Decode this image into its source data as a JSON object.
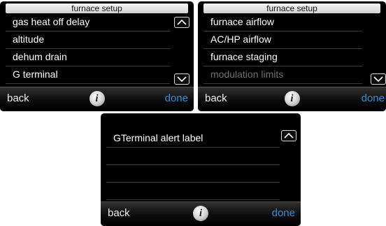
{
  "panel1": {
    "title": "furnace setup",
    "items": [
      {
        "label": "gas heat off delay"
      },
      {
        "label": "altitude"
      },
      {
        "label": "dehum drain"
      },
      {
        "label": "G terminal"
      }
    ],
    "footer": {
      "back_label": "back",
      "info_label": "i",
      "done_label": "done"
    }
  },
  "panel2": {
    "title": "furnace setup",
    "items": [
      {
        "label": "furnace airflow"
      },
      {
        "label": "AC/HP airflow"
      },
      {
        "label": "furnace staging"
      },
      {
        "label": "modulation limits"
      }
    ],
    "footer": {
      "back_label": "back",
      "info_label": "i",
      "done_label": "done"
    }
  },
  "panel3": {
    "items": [
      {
        "label": "GTerminal alert label"
      }
    ],
    "footer": {
      "back_label": "back",
      "info_label": "i",
      "done_label": "done"
    }
  },
  "icons": {
    "scroll_up": "chevron-up-icon",
    "scroll_down": "chevron-down-icon",
    "info": "info-icon"
  },
  "colors": {
    "background": "#000000",
    "text": "#ffffff",
    "done": "#2f8fd6",
    "disabled": "#6f6f6f"
  }
}
